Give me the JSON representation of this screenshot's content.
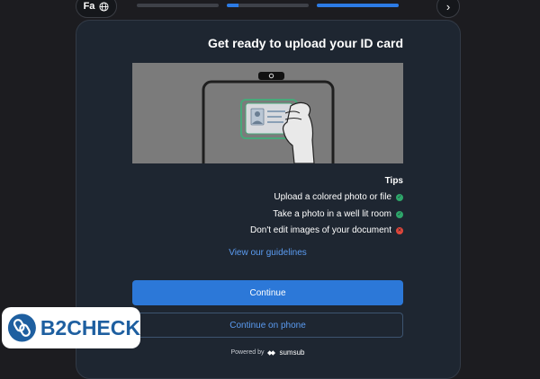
{
  "top_bar": {
    "language_code": "Fa",
    "language_icon": "globe-icon",
    "next_icon": "chevron-right-icon",
    "progress": [
      {
        "step": 1,
        "fill_fraction": 0
      },
      {
        "step": 2,
        "fill_fraction": 0.14
      },
      {
        "step": 3,
        "fill_fraction": 1
      }
    ],
    "accent_color": "#2c7be5"
  },
  "card": {
    "title": "Get ready to upload your ID card",
    "illustration_icon": "hand-holding-id-card-icon",
    "tips_title": "Tips",
    "tips": [
      {
        "text": "Upload a colored photo or file",
        "status": "ok",
        "icon": "check-circle-icon",
        "color": "#2ea66a"
      },
      {
        "text": "Take a photo in a well lit room",
        "status": "ok",
        "icon": "check-circle-icon",
        "color": "#2ea66a"
      },
      {
        "text": "Don't edit images of your document",
        "status": "bad",
        "icon": "cross-circle-icon",
        "color": "#e0473b"
      }
    ],
    "guidelines_link": "View our guidelines",
    "continue_label": "Continue",
    "continue_phone_label": "Continue on phone",
    "powered_by": "Powered by",
    "brand": "sumsub"
  },
  "watermark": {
    "text": "B2CHECK",
    "logo_icon": "b2check-chain-logo-icon"
  }
}
